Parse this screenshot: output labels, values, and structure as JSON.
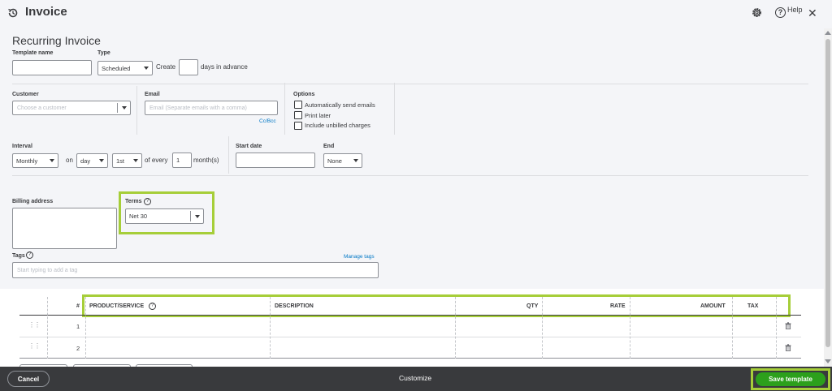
{
  "header": {
    "title": "Invoice",
    "help_label": "Help",
    "help_glyph": "?",
    "close_glyph": "✕"
  },
  "page_title": "Recurring Invoice",
  "template": {
    "name_label": "Template name",
    "name_value": "",
    "type_label": "Type",
    "type_value": "Scheduled",
    "create_label": "Create",
    "days_value": "",
    "days_suffix": "days in advance"
  },
  "customer": {
    "label": "Customer",
    "placeholder": "Choose a customer",
    "email_label": "Email",
    "email_placeholder": "Email (Separate emails with a comma)",
    "cc_bcc": "Cc/Bcc"
  },
  "options": {
    "label": "Options",
    "items": [
      {
        "label": "Automatically send emails",
        "checked": false
      },
      {
        "label": "Print later",
        "checked": false
      },
      {
        "label": "Include unbilled charges",
        "checked": false
      }
    ]
  },
  "interval": {
    "label": "Interval",
    "frequency": "Monthly",
    "on_label": "on",
    "day_value": "day",
    "ordinal_value": "1st",
    "of_every_label": "of every",
    "every_value": "1",
    "months_label": "month(s)",
    "start_date_label": "Start date",
    "start_date_value": "",
    "end_label": "End",
    "end_value": "None"
  },
  "billing": {
    "label": "Billing address",
    "value": ""
  },
  "terms": {
    "label": "Terms",
    "value": "Net 30"
  },
  "tags": {
    "label": "Tags",
    "manage_label": "Manage tags",
    "placeholder": "Start typing to add a tag"
  },
  "table": {
    "columns": {
      "num": "#",
      "product": "PRODUCT/SERVICE",
      "description": "DESCRIPTION",
      "qty": "QTY",
      "rate": "RATE",
      "amount": "AMOUNT",
      "tax": "TAX"
    },
    "rows": [
      {
        "num": "1",
        "product": "",
        "description": "",
        "qty": "",
        "rate": "",
        "amount": ""
      },
      {
        "num": "2",
        "product": "",
        "description": "",
        "qty": "",
        "rate": "",
        "amount": ""
      }
    ]
  },
  "footer": {
    "cancel": "Cancel",
    "customize": "Customize",
    "save": "Save template"
  },
  "colors": {
    "accent_highlight": "#a6ce39",
    "save_green": "#2ca01c",
    "footer_bg": "#393a3d",
    "link_blue": "#0077c5"
  }
}
